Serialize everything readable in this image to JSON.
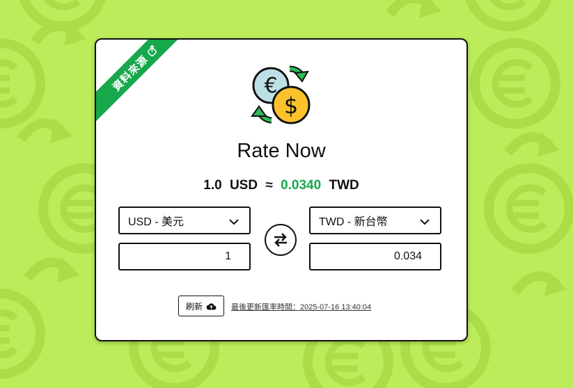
{
  "colors": {
    "background": "#bdec5a",
    "accent": "#17a84b",
    "border": "#111111"
  },
  "ribbon": {
    "label": "資料來源",
    "icon": "external-link-icon"
  },
  "header": {
    "icon": "currency-exchange-icon",
    "title": "Rate Now"
  },
  "rate": {
    "amount": "1.0",
    "from": "USD",
    "approx": "≈",
    "value": "0.0340",
    "to": "TWD"
  },
  "from": {
    "selected": "USD - 美元",
    "amount": "1"
  },
  "to": {
    "selected": "TWD - 新台幣",
    "amount": "0.034"
  },
  "swap": {
    "icon": "swap-arrows-icon"
  },
  "footer": {
    "refresh_label": "刷新",
    "refresh_icon": "cloud-upload-icon",
    "updated": "最後更新匯率時間：2025-07-16 13:40:04"
  }
}
